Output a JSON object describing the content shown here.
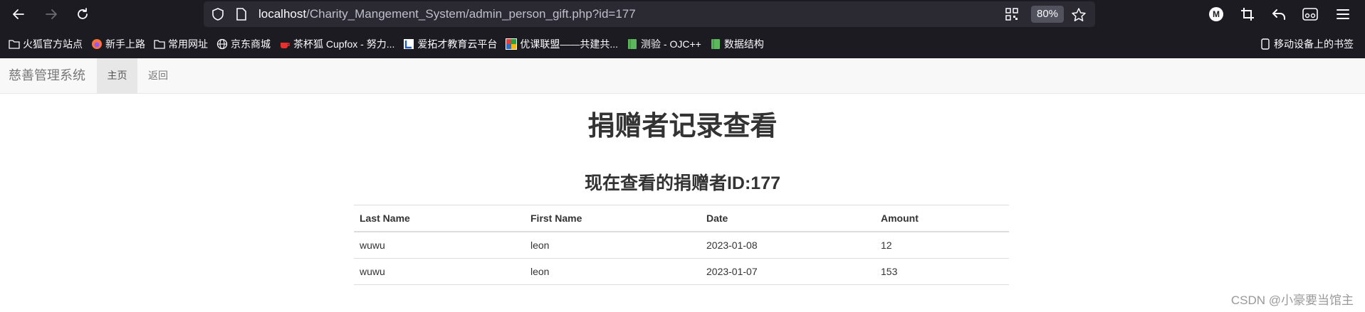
{
  "browser": {
    "url_host": "localhost",
    "url_path": "/Charity_Mangement_System/admin_person_gift.php?id=177",
    "zoom": "80%",
    "account_initial": "M",
    "bookmarks": [
      {
        "label": "火狐官方站点",
        "icon": "folder-icon"
      },
      {
        "label": "新手上路",
        "icon": "firefox-icon"
      },
      {
        "label": "常用网址",
        "icon": "folder-icon"
      },
      {
        "label": "京东商城",
        "icon": "globe-icon"
      },
      {
        "label": "茶杯狐 Cupfox - 努力...",
        "icon": "cupfox-icon"
      },
      {
        "label": "爱拓才教育云平台",
        "icon": "platform-icon"
      },
      {
        "label": "优课联盟——共建共...",
        "icon": "colorful-icon"
      },
      {
        "label": "测验 - OJC++",
        "icon": "green-book-icon"
      },
      {
        "label": "数据结构",
        "icon": "green-book-icon"
      }
    ],
    "mobile_bookmarks": "移动设备上的书签"
  },
  "navbar": {
    "brand": "慈善管理系统",
    "items": [
      {
        "label": "主页",
        "active": true
      },
      {
        "label": "返回",
        "active": false
      }
    ]
  },
  "main": {
    "title": "捐赠者记录查看",
    "subtitle": "现在查看的捐赠者ID:177",
    "table": {
      "columns": [
        "Last Name",
        "First Name",
        "Date",
        "Amount"
      ],
      "rows": [
        [
          "wuwu",
          "leon",
          "2023-01-08",
          "12"
        ],
        [
          "wuwu",
          "leon",
          "2023-01-07",
          "153"
        ]
      ]
    }
  },
  "watermark": "CSDN @小豪要当馆主",
  "colors": {
    "chrome_bg": "#1c1b22",
    "urlbar_bg": "#2b2a33",
    "navbar_bg": "#f8f8f8",
    "active_nav_bg": "#e7e7e7",
    "text": "#333333"
  }
}
